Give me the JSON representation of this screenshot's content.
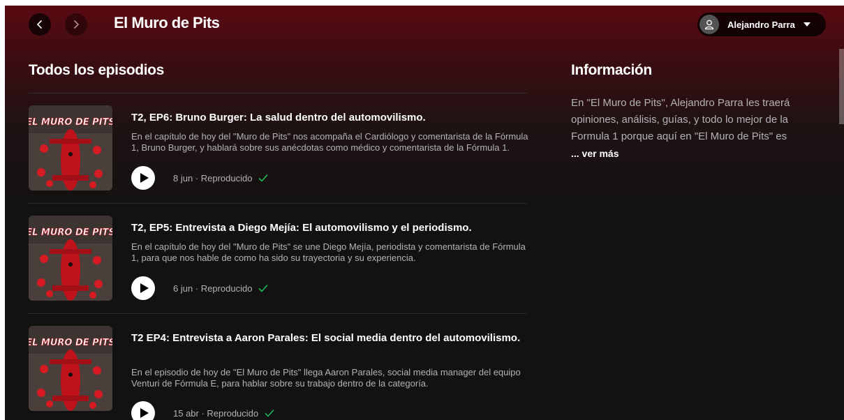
{
  "header": {
    "title": "El Muro de Pits",
    "user_name": "Alejandro Parra"
  },
  "icons": {
    "back": "chevron-left-icon",
    "forward": "chevron-right-icon",
    "user": "user-icon",
    "dropdown": "caret-down-icon",
    "play": "play-icon",
    "played": "check-icon"
  },
  "colors": {
    "header_bg": "#5a0a11",
    "background": "#121212",
    "played_check": "#1db954"
  },
  "episodes_section": {
    "title": "Todos los episodios",
    "items": [
      {
        "title": "T2, EP6: Bruno Burger: La salud dentro del automovilismo.",
        "description": "En el capítulo de hoy del \"Muro de Pits\" nos acompaña el Cardiólogo y comentarista de la Fórmula 1, Bruno Burger, y hablará sobre sus anécdotas como médico y comentarista de la Fórmula 1.",
        "meta": "8 jun · Reproducido",
        "art_label": "EL MURO DE PITS"
      },
      {
        "title": "T2, EP5: Entrevista a Diego Mejía: El automovilismo y el periodismo.",
        "description": "En el capítulo de hoy del \"Muro de Pits\" se une Diego Mejía, periodista y comentarista de Fórmula 1, para que nos hable de como ha sido su trayectoria y su experiencia.",
        "meta": "6 jun · Reproducido",
        "art_label": "EL MURO DE PITS"
      },
      {
        "title": "T2 EP4: Entrevista a Aaron Parales: El social media dentro del automovilismo.",
        "description": "En el episodio de hoy de \"El Muro de Pits\" llega Aaron Parales, social media manager del equipo Venturi de Fórmula E, para hablar sobre su trabajo dentro de la categoría.",
        "meta": "15 abr · Reproducido",
        "art_label": "EL MURO DE PITS"
      }
    ]
  },
  "info_section": {
    "title": "Información",
    "text": "En \"El Muro de Pits\", Alejandro Parra les traerá opiniones, análisis, guías, y todo lo mejor de la Formula 1 porque aquí en \"El Muro de Pits\" es",
    "see_more": "... ver más"
  }
}
